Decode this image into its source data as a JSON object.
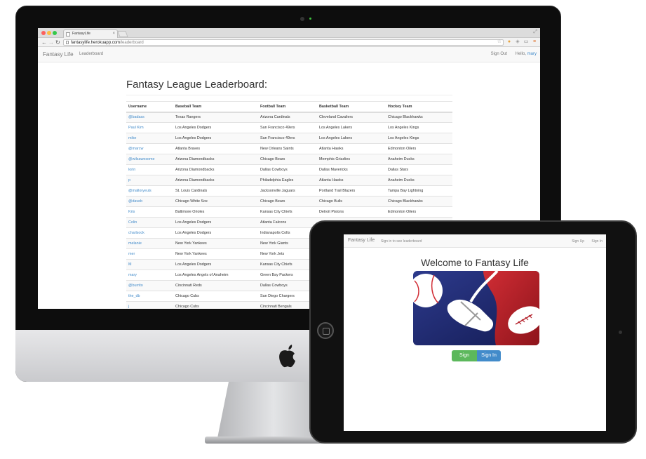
{
  "browser": {
    "tab_title": "FantasyLife",
    "tab_close": "×",
    "url_host": "fantasylife.herokuapp.com",
    "url_path": "/leaderboard"
  },
  "desktop_nav": {
    "brand": "Fantasy Life",
    "leaderboard": "Leaderboard",
    "sign_out": "Sign Out",
    "hello_prefix": "Hello,",
    "username": "mary"
  },
  "leaderboard": {
    "title": "Fantasy League Leaderboard:",
    "columns": [
      "Username",
      "Baseball Team",
      "Football Team",
      "Basketball Team",
      "Hockey Team"
    ],
    "rows": [
      [
        "@badass",
        "Texas Rangers",
        "Arizona Cardinals",
        "Cleveland Cavaliers",
        "Chicago Blackhawks"
      ],
      [
        "Paul Kim",
        "Los Angeles Dodgers",
        "San Francisco 49ers",
        "Los Angeles Lakers",
        "Los Angeles Kings"
      ],
      [
        "mike",
        "Los Angeles Dodgers",
        "San Francisco 49ers",
        "Los Angeles Lakers",
        "Los Angeles Kings"
      ],
      [
        "@marcw",
        "Atlanta Braves",
        "New Orleans Saints",
        "Atlanta Hawks",
        "Edmonton Oilers"
      ],
      [
        "@wilsawesome",
        "Arizona Diamondbacks",
        "Chicago Bears",
        "Memphis Grizzlies",
        "Anaheim Ducks"
      ],
      [
        "lorin",
        "Arizona Diamondbacks",
        "Dallas Cowboys",
        "Dallas Mavericks",
        "Dallas Stars"
      ],
      [
        "p",
        "Arizona Diamondbacks",
        "Philadelphia Eagles",
        "Atlanta Hawks",
        "Anaheim Ducks"
      ],
      [
        "@malloryeuls",
        "St. Louis Cardinals",
        "Jacksonville Jaguars",
        "Portland Trail Blazers",
        "Tampa Bay Lightning"
      ],
      [
        "@daveb",
        "Chicago White Sox",
        "Chicago Bears",
        "Chicago Bulls",
        "Chicago Blackhawks"
      ],
      [
        "Kris",
        "Baltimore Orioles",
        "Kansas City Chiefs",
        "Detroit Pistons",
        "Edmonton Oilers"
      ],
      [
        "Colin",
        "Los Angeles Dodgers",
        "Atlanta Falcons",
        "",
        ""
      ],
      [
        "charlsock",
        "Los Angeles Dodgers",
        "Indianapolis Colts",
        "",
        ""
      ],
      [
        "melanie",
        "New York Yankees",
        "New York Giants",
        "",
        ""
      ],
      [
        "mer",
        "New York Yankees",
        "New York Jets",
        "",
        ""
      ],
      [
        "M",
        "Los Angeles Dodgers",
        "Kansas City Chiefs",
        "",
        ""
      ],
      [
        "mary",
        "Los Angeles Angels of Anaheim",
        "Green Bay Packers",
        "",
        ""
      ],
      [
        "@burrito",
        "Cincinnati Reds",
        "Dallas Cowboys",
        "",
        ""
      ],
      [
        "the_db",
        "Chicago Cubs",
        "San Diego Chargers",
        "",
        ""
      ],
      [
        "j",
        "Chicago Cubs",
        "Cincinnati Bengals",
        "",
        ""
      ]
    ]
  },
  "ipad": {
    "brand": "Fantasy Life",
    "signin_to_see": "Sign in to see leaderboard",
    "sign_up": "Sign Up",
    "sign_in": "Sign In",
    "welcome": "Welcome to Fantasy Life",
    "btn_sign_up": "Sign Up",
    "btn_sign_in": "Sign In"
  },
  "colors": {
    "link": "#428bca",
    "logo_blue": "#1e2a73",
    "logo_red": "#b3202a",
    "btn_green": "#5cb85c",
    "btn_blue": "#428bca"
  },
  "icons": [
    "apple-logo-icon",
    "back-arrow-icon",
    "forward-arrow-icon",
    "reload-icon",
    "star-icon",
    "menu-icon",
    "baseball-icon",
    "football-icon",
    "mouse-icon"
  ]
}
